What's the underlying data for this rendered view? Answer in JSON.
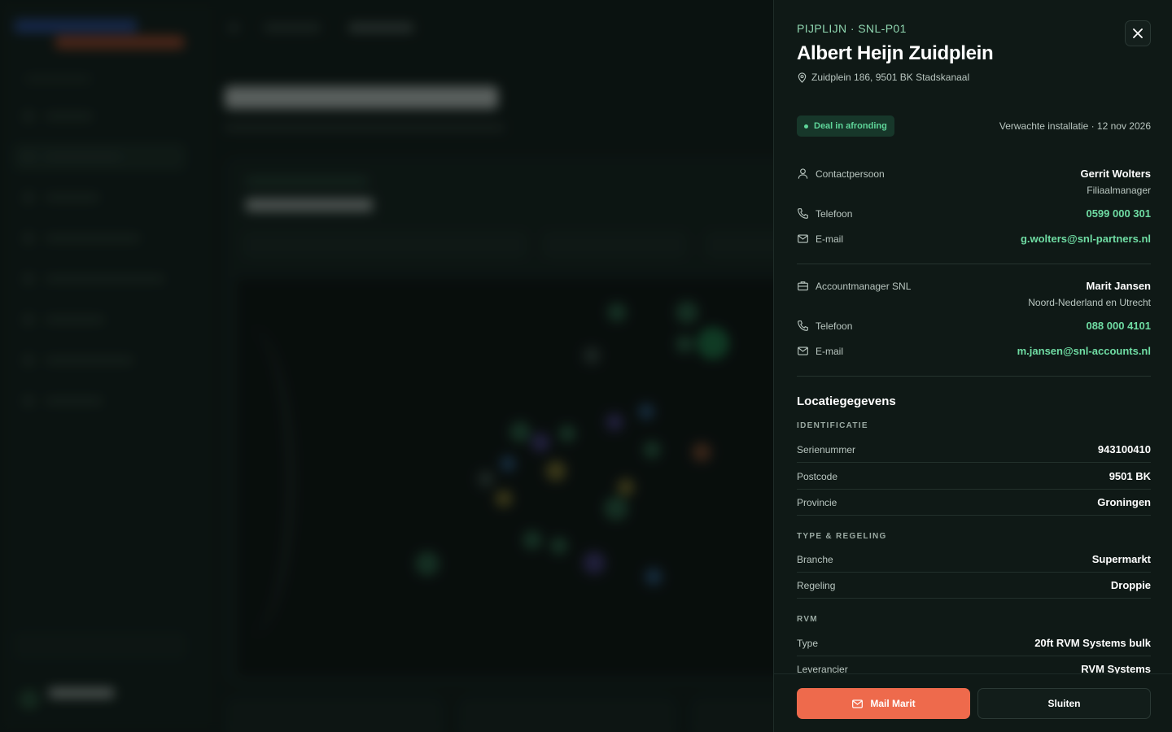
{
  "drawer": {
    "eyebrow": "PIJPLIJN · SNL-P01",
    "title": "Albert Heijn Zuidplein",
    "address": "Zuidplein 186, 9501 BK Stadskanaal",
    "status_badge": "Deal in afronding",
    "expected_install": "Verwachte installatie · 12 nov 2026",
    "contact": {
      "label": "Contactpersoon",
      "name": "Gerrit Wolters",
      "role": "Filiaalmanager",
      "phone_label": "Telefoon",
      "phone": "0599 000 301",
      "email_label": "E-mail",
      "email": "g.wolters@snl-partners.nl"
    },
    "account_manager": {
      "label": "Accountmanager SNL",
      "name": "Marit Jansen",
      "region": "Noord-Nederland en Utrecht",
      "phone_label": "Telefoon",
      "phone": "088 000 4101",
      "email_label": "E-mail",
      "email": "m.jansen@snl-accounts.nl"
    },
    "location": {
      "section_title": "Locatiegegevens",
      "identification_label": "IDENTIFICATIE",
      "identification": [
        {
          "key": "Serienummer",
          "value": "943100410"
        },
        {
          "key": "Postcode",
          "value": "9501 BK"
        },
        {
          "key": "Provincie",
          "value": "Groningen"
        }
      ],
      "type_label": "TYPE & REGELING",
      "type": [
        {
          "key": "Branche",
          "value": "Supermarkt"
        },
        {
          "key": "Regeling",
          "value": "Droppie"
        }
      ],
      "rvm_label": "RVM",
      "rvm": [
        {
          "key": "Type",
          "value": "20ft RVM Systems bulk"
        },
        {
          "key": "Leverancier",
          "value": "RVM Systems"
        }
      ]
    },
    "footer": {
      "primary_label": "Mail Marit",
      "secondary_label": "Sluiten"
    }
  },
  "colors": {
    "accent_green": "#6fdca3",
    "primary_button": "#ee6a4c",
    "badge_bg": "#17372a",
    "panel_bg": "#0f1916"
  },
  "icons": [
    "close-icon",
    "map-pin-icon",
    "user-icon",
    "phone-icon",
    "mail-icon",
    "briefcase-icon"
  ]
}
